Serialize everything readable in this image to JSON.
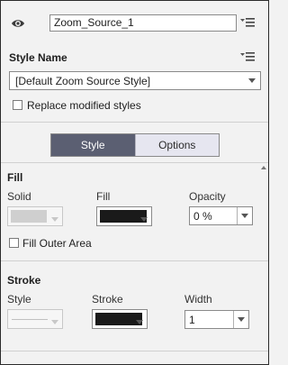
{
  "header": {
    "name_value": "Zoom_Source_1"
  },
  "style_name": {
    "label": "Style Name",
    "selected": "[Default Zoom Source Style]",
    "replace_label": "Replace modified styles"
  },
  "tabs": [
    {
      "label": "Style",
      "active": true
    },
    {
      "label": "Options",
      "active": false
    }
  ],
  "fill": {
    "title": "Fill",
    "solid_label": "Solid",
    "fill_label": "Fill",
    "opacity_label": "Opacity",
    "opacity_value": "0 %",
    "fill_color": "#1a1a1a",
    "solid_color": "#cfcfcf",
    "outer_area_label": "Fill Outer Area"
  },
  "stroke": {
    "title": "Stroke",
    "style_label": "Style",
    "stroke_label": "Stroke",
    "width_label": "Width",
    "width_value": "1",
    "stroke_color": "#1a1a1a"
  },
  "colors": {
    "tab_active_bg": "#5b5f72",
    "tab_inactive_bg": "#e6e6f0",
    "panel_bg": "#f2f2f2"
  }
}
